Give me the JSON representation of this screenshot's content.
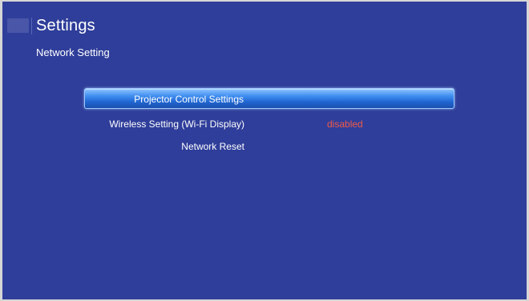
{
  "header": {
    "title": "Settings",
    "subtitle": "Network Setting",
    "icon": "settings-app-icon"
  },
  "menu": {
    "items": [
      {
        "label": "Projector Control Settings",
        "value": "",
        "selected": true
      },
      {
        "label": "Wireless Setting (Wi-Fi Display)",
        "value": "disabled",
        "selected": false
      },
      {
        "label": "Network Reset",
        "value": "",
        "selected": false
      }
    ]
  },
  "colors": {
    "background": "#2f3e9a",
    "selection": "#2f78e6",
    "value_disabled": "#f15a4b",
    "text": "#ffffff"
  }
}
